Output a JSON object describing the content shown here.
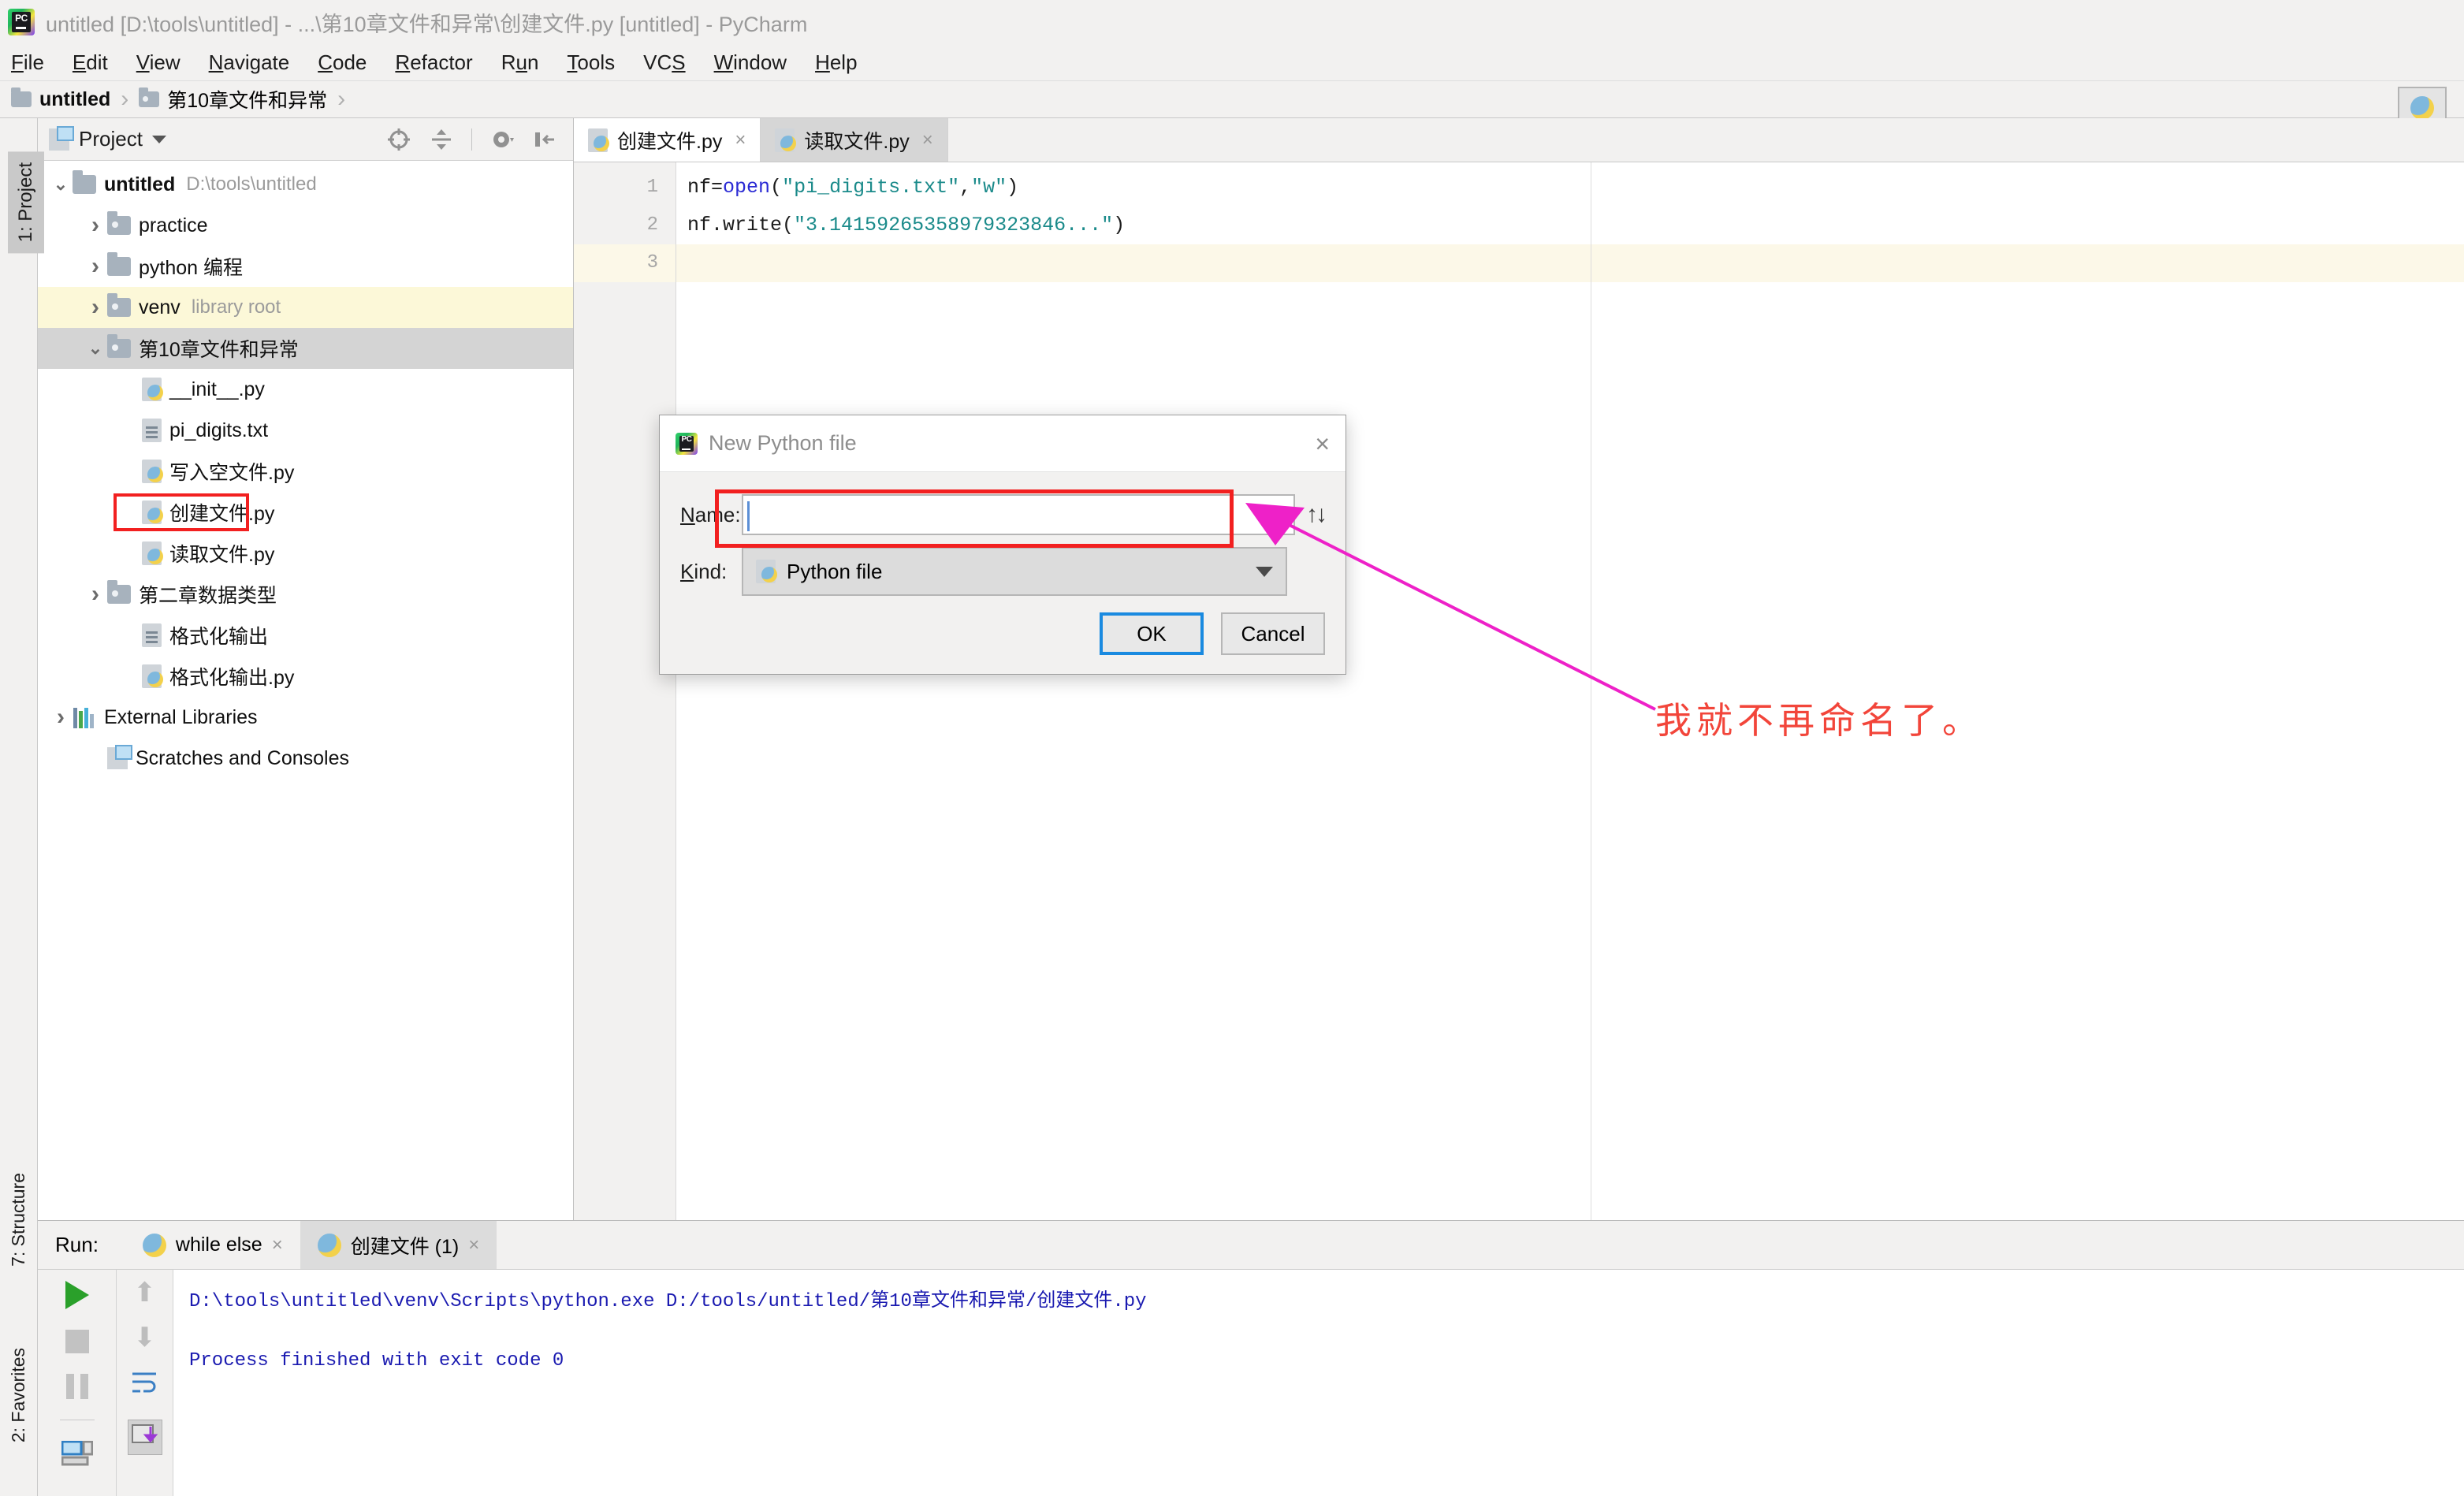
{
  "window": {
    "title": "untitled [D:\\tools\\untitled] - ...\\第10章文件和异常\\创建文件.py [untitled] - PyCharm",
    "logo_text": "PC"
  },
  "menubar": [
    {
      "label": "File",
      "mnemonic": "F"
    },
    {
      "label": "Edit",
      "mnemonic": "E"
    },
    {
      "label": "View",
      "mnemonic": "V"
    },
    {
      "label": "Navigate",
      "mnemonic": "N"
    },
    {
      "label": "Code",
      "mnemonic": "C"
    },
    {
      "label": "Refactor",
      "mnemonic": "R"
    },
    {
      "label": "Run",
      "mnemonic": "u"
    },
    {
      "label": "Tools",
      "mnemonic": "T"
    },
    {
      "label": "VCS",
      "mnemonic": "S"
    },
    {
      "label": "Window",
      "mnemonic": "W"
    },
    {
      "label": "Help",
      "mnemonic": "H"
    }
  ],
  "breadcrumb": {
    "items": [
      "untitled",
      "第10章文件和异常"
    ],
    "separator": "›"
  },
  "left_strip": {
    "project_tab": "1: Project"
  },
  "bottom_strip": {
    "structure_tab": "7: Structure",
    "favorites_tab": "2: Favorites"
  },
  "project_panel": {
    "title": "Project",
    "tools": [
      "locate-icon",
      "collapse-all-icon",
      "settings-gear-icon",
      "hide-icon"
    ],
    "tree": [
      {
        "label": "untitled",
        "sub": "D:\\tools\\untitled",
        "icon": "folder-icon",
        "indent": 0,
        "arrow": "down",
        "bold": true,
        "state": "normal"
      },
      {
        "label": "practice",
        "sub": "",
        "icon": "folder-dot-icon",
        "indent": 1,
        "arrow": "right",
        "bold": false,
        "state": "normal"
      },
      {
        "label": "python 编程",
        "sub": "",
        "icon": "folder-icon",
        "indent": 1,
        "arrow": "right",
        "bold": false,
        "state": "normal"
      },
      {
        "label": "venv",
        "sub": "library root",
        "icon": "folder-dot-icon",
        "indent": 1,
        "arrow": "right",
        "bold": false,
        "state": "highlight"
      },
      {
        "label": "第10章文件和异常",
        "sub": "",
        "icon": "folder-dot-icon",
        "indent": 1,
        "arrow": "down",
        "bold": false,
        "state": "selected"
      },
      {
        "label": "__init__.py",
        "sub": "",
        "icon": "python-file-icon",
        "indent": 2,
        "arrow": "",
        "bold": false,
        "state": "normal"
      },
      {
        "label": "pi_digits.txt",
        "sub": "",
        "icon": "text-file-icon",
        "indent": 2,
        "arrow": "",
        "bold": false,
        "state": "normal"
      },
      {
        "label": "写入空文件.py",
        "sub": "",
        "icon": "python-file-icon",
        "indent": 2,
        "arrow": "",
        "bold": false,
        "state": "normal"
      },
      {
        "label": "创建文件.py",
        "sub": "",
        "icon": "python-file-icon",
        "indent": 2,
        "arrow": "",
        "bold": false,
        "state": "redbox"
      },
      {
        "label": "读取文件.py",
        "sub": "",
        "icon": "python-file-icon",
        "indent": 2,
        "arrow": "",
        "bold": false,
        "state": "normal"
      },
      {
        "label": "第二章数据类型",
        "sub": "",
        "icon": "folder-dot-icon",
        "indent": 1,
        "arrow": "right",
        "bold": false,
        "state": "normal"
      },
      {
        "label": "格式化输出",
        "sub": "",
        "icon": "text-file-icon",
        "indent": 2,
        "arrow": "",
        "bold": false,
        "state": "normal"
      },
      {
        "label": "格式化输出.py",
        "sub": "",
        "icon": "python-file-icon",
        "indent": 2,
        "arrow": "",
        "bold": false,
        "state": "normal"
      },
      {
        "label": "External Libraries",
        "sub": "",
        "icon": "library-icon",
        "indent": 0,
        "arrow": "right",
        "bold": false,
        "state": "normal"
      },
      {
        "label": "Scratches and Consoles",
        "sub": "",
        "icon": "scratch-icon",
        "indent": 1,
        "arrow": "",
        "bold": false,
        "state": "normal"
      }
    ]
  },
  "editor": {
    "tabs": [
      {
        "label": "创建文件.py",
        "active": true,
        "close": "×"
      },
      {
        "label": "读取文件.py",
        "active": false,
        "close": "×"
      }
    ],
    "line_numbers": [
      "1",
      "2",
      "3"
    ],
    "lines": [
      {
        "num": "1",
        "var": "nf",
        "eq": "=",
        "fn": "open",
        "args": "(\"pi_digits.txt\",\"w\")",
        "current": false
      },
      {
        "num": "2",
        "var": "nf.write",
        "eq": "",
        "fn": "",
        "args": "(\"3.14159265358979323846...\")",
        "current": false
      },
      {
        "num": "3",
        "var": "",
        "eq": "",
        "fn": "",
        "args": "",
        "current": true
      }
    ],
    "code_text_1": "nf=open(\"pi_digits.txt\",\"w\")",
    "code_text_2": "nf.write(\"3.14159265358979323846...\")"
  },
  "dialog": {
    "title": "New Python file",
    "close_icon": "×",
    "name_label": "Name:",
    "name_mnemonic": "N",
    "name_value": "",
    "kind_label": "Kind:",
    "kind_mnemonic": "K",
    "kind_value": "Python file",
    "swap_icon": "↑↓",
    "ok_label": "OK",
    "cancel_label": "Cancel",
    "highlight_color": "#f22020",
    "focus_color": "#1a8ae0"
  },
  "annotation": {
    "text": "我就不再命名了。",
    "color": "#f2453a",
    "arrow_color": "#ee21c8"
  },
  "run_panel": {
    "label": "Run:",
    "tabs": [
      {
        "label": "while else",
        "active": false,
        "close": "×"
      },
      {
        "label": "创建文件 (1)",
        "active": true,
        "close": "×"
      }
    ],
    "toolbar_left": [
      "run-icon",
      "stop-icon",
      "pause-icon",
      "layout-icon"
    ],
    "toolbar_right": [
      "scroll-up-icon",
      "scroll-down-icon",
      "soft-wrap-icon",
      "scroll-to-end-icon"
    ],
    "console_lines": [
      "D:\\tools\\untitled\\venv\\Scripts\\python.exe D:/tools/untitled/第10章文件和异常/创建文件.py",
      "Process finished with exit code 0"
    ]
  }
}
